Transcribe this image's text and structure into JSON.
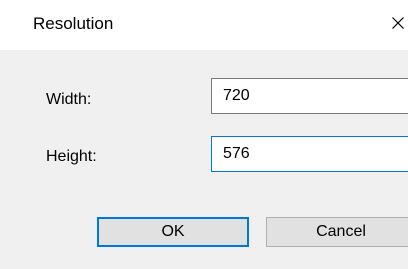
{
  "dialog": {
    "title": "Resolution",
    "close_icon": "close-icon",
    "width_label": "Width:",
    "width_value": "720",
    "height_label": "Height:",
    "height_value": "576",
    "ok_label": "OK",
    "cancel_label": "Cancel"
  },
  "colors": {
    "focus_border": "#0078d7",
    "content_background": "#f0f0f0",
    "button_face": "#e1e1e1"
  }
}
